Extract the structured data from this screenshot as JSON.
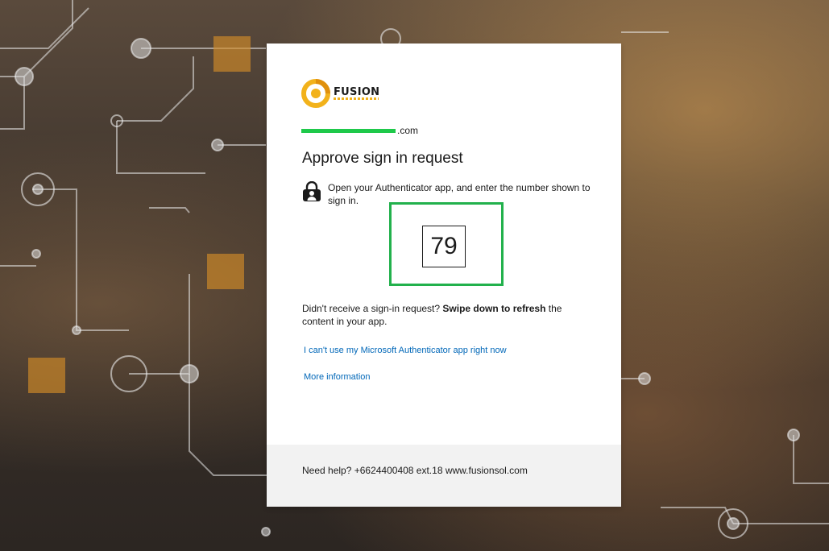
{
  "brand": {
    "name": "FUSION",
    "accent_color": "#f2b21b",
    "logo_icon": "fusion-logo-icon"
  },
  "identity": {
    "email_suffix": ".com",
    "redaction_color": "#1ec94a"
  },
  "page": {
    "title": "Approve sign in request"
  },
  "instruction": {
    "icon": "authenticator-lock-icon",
    "text": "Open your Authenticator app, and enter the number shown to sign in."
  },
  "number": {
    "value": "79",
    "highlight_color": "#22b14c"
  },
  "refresh": {
    "prefix": "Didn't receive a sign-in request? ",
    "bold": "Swipe down to refresh",
    "suffix": " the content in your app."
  },
  "links": {
    "cant_use": "I can't use my Microsoft Authenticator app right now",
    "more_info": "More information",
    "color": "#0067b8"
  },
  "footer": {
    "text": "Need help? +6624400408 ext.18 www.fusionsol.com"
  }
}
